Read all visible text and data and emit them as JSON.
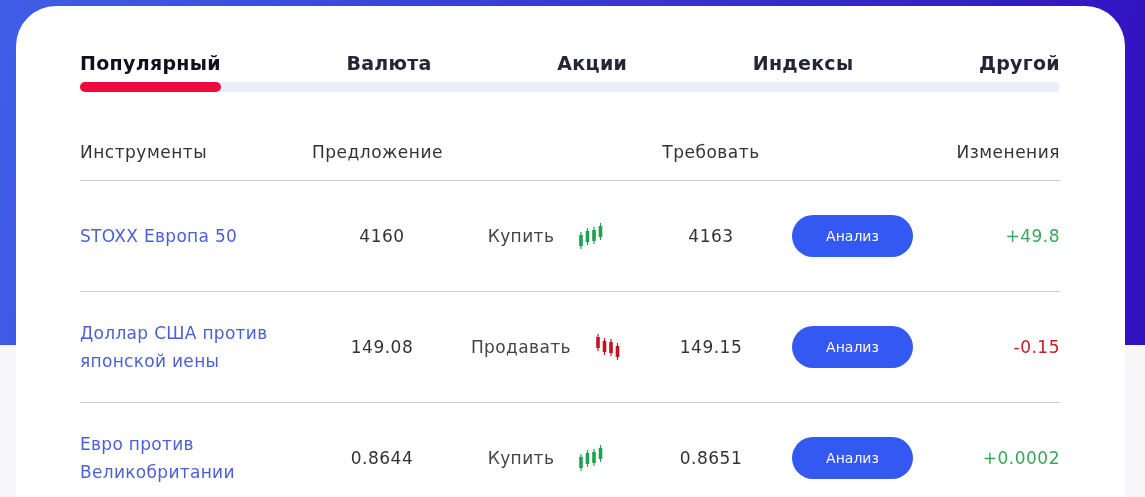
{
  "tabs": [
    {
      "label": "Популярный",
      "selected": true
    },
    {
      "label": "Валюта",
      "selected": false
    },
    {
      "label": "Акции",
      "selected": false
    },
    {
      "label": "Индексы",
      "selected": false
    },
    {
      "label": "Другой",
      "selected": false
    }
  ],
  "table": {
    "columns": [
      "Инструменты",
      "Предложение",
      "Требовать",
      "Изменения"
    ],
    "rows": [
      {
        "instrument": "STOXX Европа 50",
        "bid": "4160",
        "action": "Купить",
        "kind": "up",
        "ask": "4163",
        "button": "Анализ",
        "change": "+49.8"
      },
      {
        "instrument": "Доллар США против японской иены",
        "bid": "149.08",
        "action": "Продавать",
        "kind": "down",
        "ask": "149.15",
        "button": "Анализ",
        "change": "-0.15"
      },
      {
        "instrument": "Евро против Великобритании",
        "bid": "0.8644",
        "action": "Купить",
        "kind": "up",
        "ask": "0.8651",
        "button": "Анализ",
        "change": "+0.0002"
      }
    ]
  }
}
